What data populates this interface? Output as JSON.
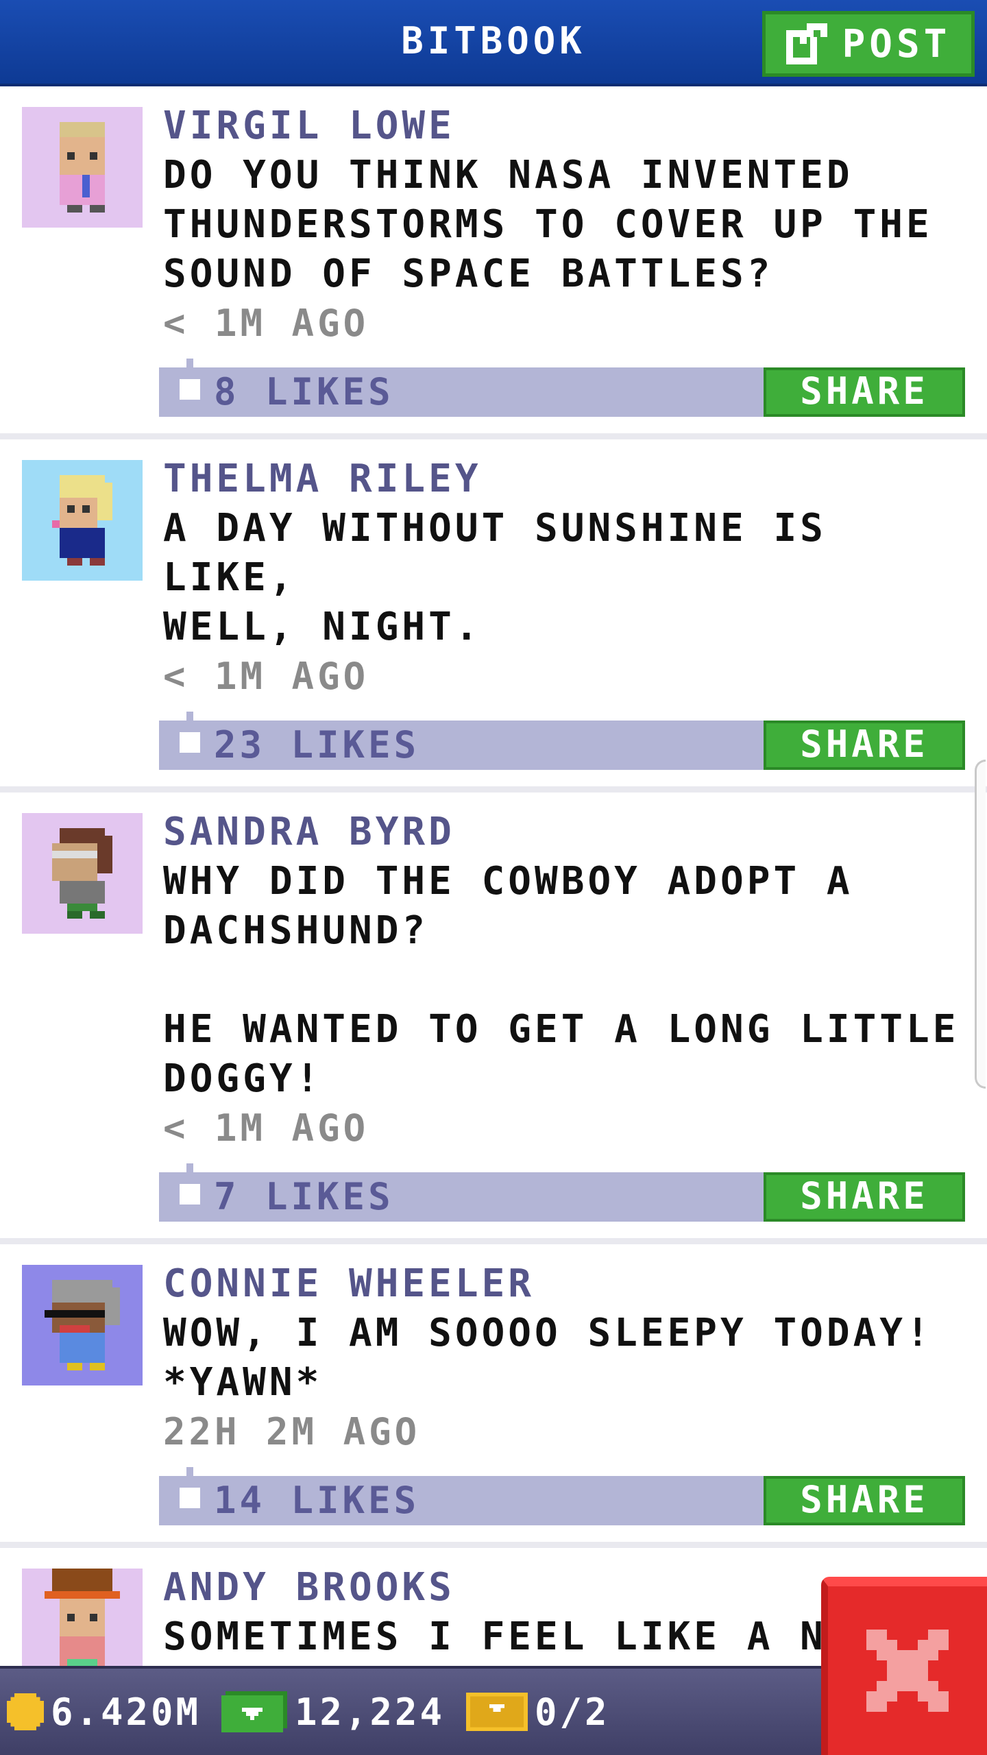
{
  "header": {
    "title": "BITBOOK",
    "post_label": "POST"
  },
  "posts": [
    {
      "author": "VIRGIL LOWE",
      "message": "DO YOU THINK NASA INVENTED\nTHUNDERSTORMS TO COVER UP THE\nSOUND OF SPACE BATTLES?",
      "time": "< 1M AGO",
      "likes": "8 LIKES",
      "share": "SHARE",
      "avatar_bg": "#e3c6f0"
    },
    {
      "author": "THELMA RILEY",
      "message": "A DAY WITHOUT SUNSHINE IS LIKE,\nWELL, NIGHT.",
      "time": "< 1M AGO",
      "likes": "23 LIKES",
      "share": "SHARE",
      "avatar_bg": "#9fdcf7"
    },
    {
      "author": "SANDRA BYRD",
      "message": "WHY DID THE COWBOY ADOPT A\nDACHSHUND?\n\nHE WANTED TO GET A LONG LITTLE\nDOGGY!",
      "time": "< 1M AGO",
      "likes": "7 LIKES",
      "share": "SHARE",
      "avatar_bg": "#e3c6f0"
    },
    {
      "author": "CONNIE WHEELER",
      "message": "WOW, I AM SOOOO SLEEPY TODAY!\n*YAWN*",
      "time": "22H 2M AGO",
      "likes": "14 LIKES",
      "share": "SHARE",
      "avatar_bg": "#8e88e8"
    },
    {
      "author": "ANDY BROOKS",
      "message": "SOMETIMES I FEEL LIKE A NUT,\nSOMETIMES I DON'T.",
      "time": "",
      "likes": "",
      "share": "",
      "avatar_bg": "#e3c6f0"
    }
  ],
  "status": {
    "coins": "6.420M",
    "bux": "12,224",
    "tickets": "0/2"
  },
  "colors": {
    "header": "#1a4db3",
    "accent_green": "#3fae3a",
    "likes_bar": "#b3b5d6",
    "author": "#55558a",
    "close": "#e52a2a"
  },
  "icons": {
    "post": "edit-icon",
    "thumb": "thumbs-up-icon",
    "coin": "coin-icon",
    "bux": "bux-icon",
    "ticket": "ticket-icon",
    "close": "close-icon"
  }
}
